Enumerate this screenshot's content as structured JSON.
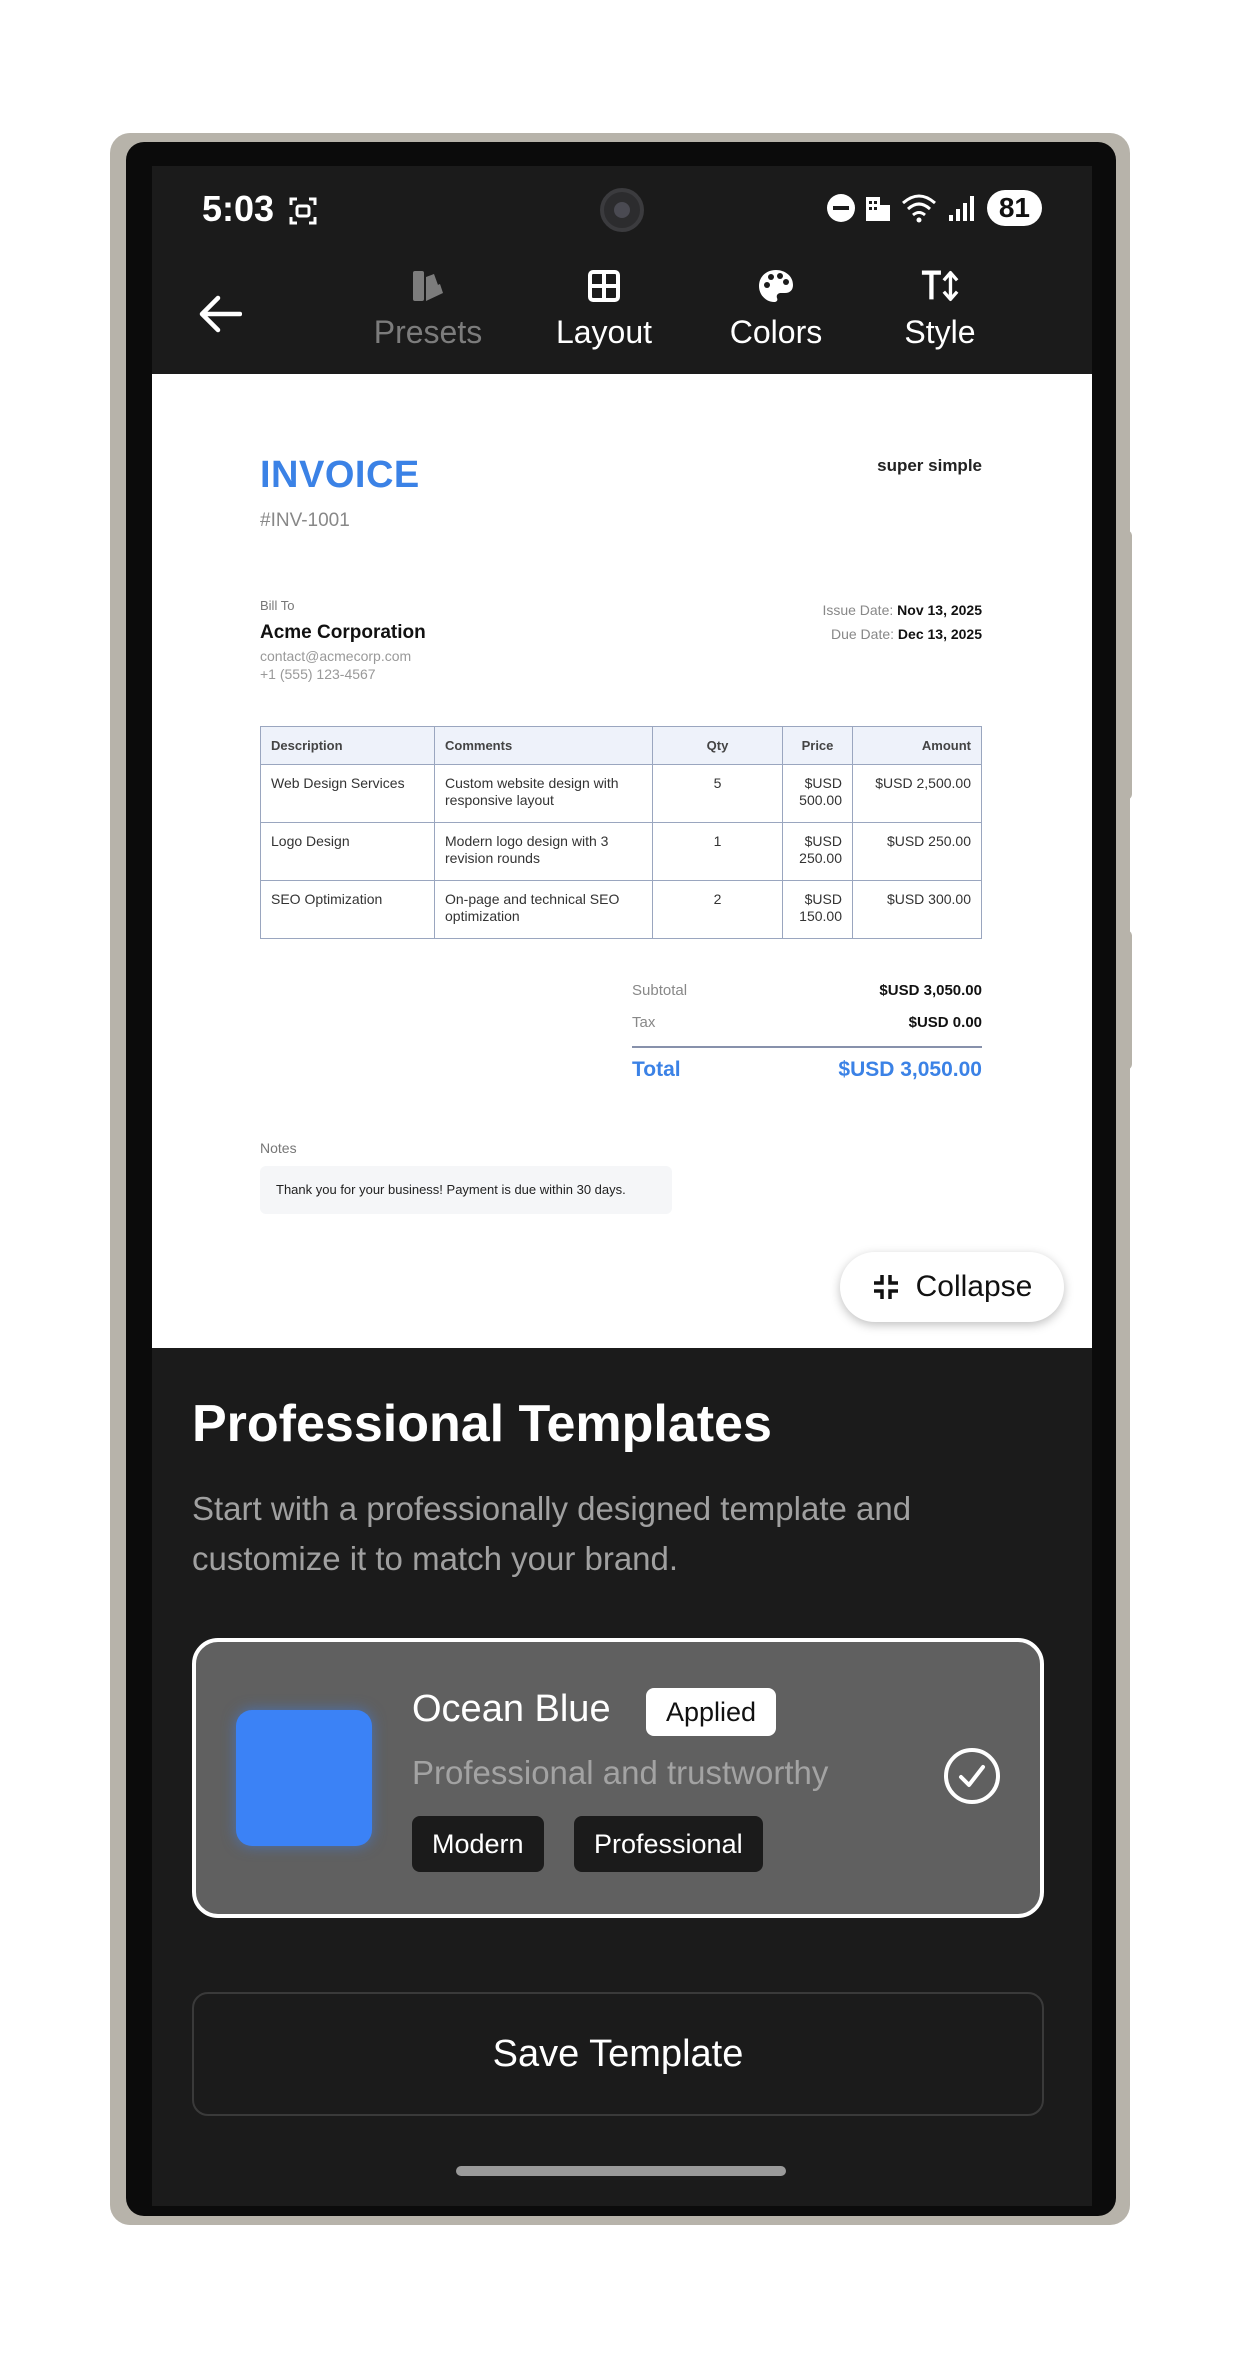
{
  "status_bar": {
    "time": "5:03",
    "battery": "81"
  },
  "toolbar": {
    "tabs": [
      {
        "label": "Presets",
        "icon": "swatch-book-icon",
        "disabled": true
      },
      {
        "label": "Layout",
        "icon": "layout-grid-icon",
        "disabled": false
      },
      {
        "label": "Colors",
        "icon": "palette-icon",
        "disabled": false
      },
      {
        "label": "Style",
        "icon": "text-size-icon",
        "disabled": false
      }
    ]
  },
  "invoice": {
    "title": "INVOICE",
    "number": "#INV-1001",
    "brand": "super simple",
    "bill_to_label": "Bill To",
    "client_name": "Acme Corporation",
    "client_email": "contact@acmecorp.com",
    "client_phone": "+1 (555) 123-4567",
    "issue_date_label": "Issue Date:",
    "issue_date": "Nov 13, 2025",
    "due_date_label": "Due Date:",
    "due_date": "Dec 13, 2025",
    "columns": [
      "Description",
      "Comments",
      "Qty",
      "Price",
      "Amount"
    ],
    "rows": [
      {
        "description": "Web Design Services",
        "comments": "Custom website design with responsive layout",
        "qty": "5",
        "price": "$USD 500.00",
        "amount": "$USD 2,500.00"
      },
      {
        "description": "Logo Design",
        "comments": "Modern logo design with 3 revision rounds",
        "qty": "1",
        "price": "$USD 250.00",
        "amount": "$USD 250.00"
      },
      {
        "description": "SEO Optimization",
        "comments": "On-page and technical SEO optimization",
        "qty": "2",
        "price": "$USD 150.00",
        "amount": "$USD 300.00"
      }
    ],
    "subtotal_label": "Subtotal",
    "subtotal": "$USD 3,050.00",
    "tax_label": "Tax",
    "tax": "$USD 0.00",
    "total_label": "Total",
    "total": "$USD 3,050.00",
    "notes_label": "Notes",
    "notes": "Thank you for your business! Payment is due within 30 days.",
    "accent_color": "#3b82e6"
  },
  "preview": {
    "collapse_label": "Collapse"
  },
  "templates": {
    "title": "Professional Templates",
    "description": "Start with a professionally designed template and customize it to match your brand.",
    "selected": {
      "name": "Ocean Blue",
      "badge": "Applied",
      "subtitle": "Professional and trustworthy",
      "tags": [
        "Modern",
        "Professional"
      ],
      "swatch_color": "#3b82f6"
    }
  },
  "actions": {
    "save_label": "Save Template"
  }
}
